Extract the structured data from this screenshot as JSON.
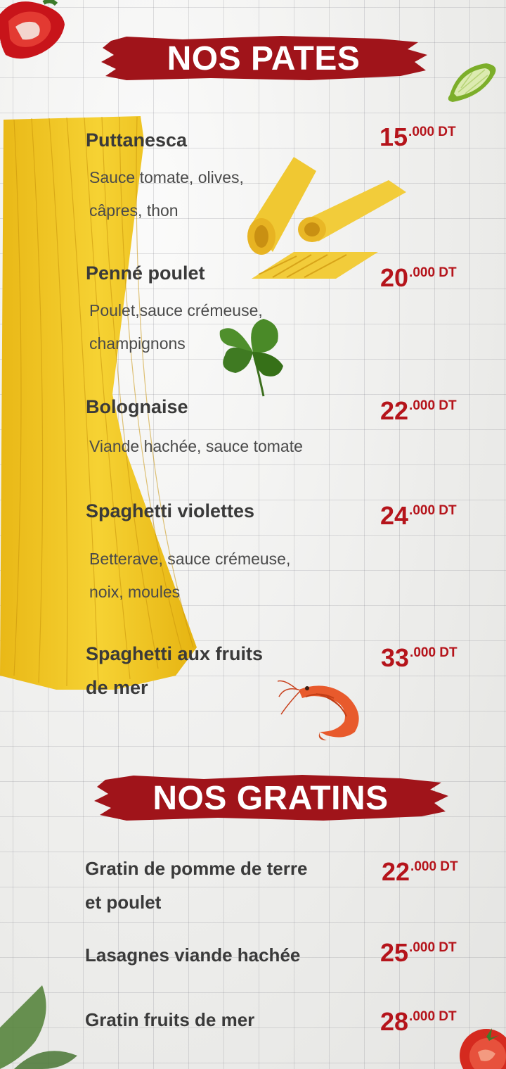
{
  "sections": {
    "pates": {
      "title": "NOS PATES",
      "items": [
        {
          "name_line1": "Puttanesca",
          "desc_line1": "Sauce tomate, olives,",
          "desc_line2": "câpres, thon",
          "price_main": "15",
          "price_cents": ".000 DT"
        },
        {
          "name_line1": "Penné poulet",
          "desc_line1": "Poulet,sauce crémeuse,",
          "desc_line2": "champignons",
          "price_main": "20",
          "price_cents": ".000 DT"
        },
        {
          "name_line1": "Bolognaise",
          "desc_line1": "Viande hachée, sauce tomate",
          "price_main": "22",
          "price_cents": ".000 DT"
        },
        {
          "name_line1": "Spaghetti violettes",
          "desc_line1": "Betterave, sauce crémeuse,",
          "desc_line2": "noix, moules",
          "price_main": "24",
          "price_cents": ".000 DT"
        },
        {
          "name_line1": "Spaghetti aux fruits",
          "name_line2": "de mer",
          "price_main": "33",
          "price_cents": ".000 DT"
        }
      ]
    },
    "gratins": {
      "title": "NOS GRATINS",
      "items": [
        {
          "name_line1": "Gratin de pomme de terre",
          "name_line2": "et poulet",
          "price_main": "22",
          "price_cents": ".000 DT"
        },
        {
          "name_line1": "Lasagnes viande hachée",
          "price_main": "25",
          "price_cents": ".000 DT"
        },
        {
          "name_line1": "Gratin fruits de mer",
          "price_main": "28",
          "price_cents": ".000 DT"
        }
      ]
    }
  },
  "colors": {
    "accent": "#b5141b",
    "banner": "#a0141a",
    "text": "#3a3a3a"
  },
  "decorations": [
    "red-pepper-icon",
    "lime-icon",
    "spaghetti-icon",
    "penne-icon",
    "parsley-icon",
    "shrimp-icon",
    "basil-icon",
    "tomato-icon"
  ]
}
